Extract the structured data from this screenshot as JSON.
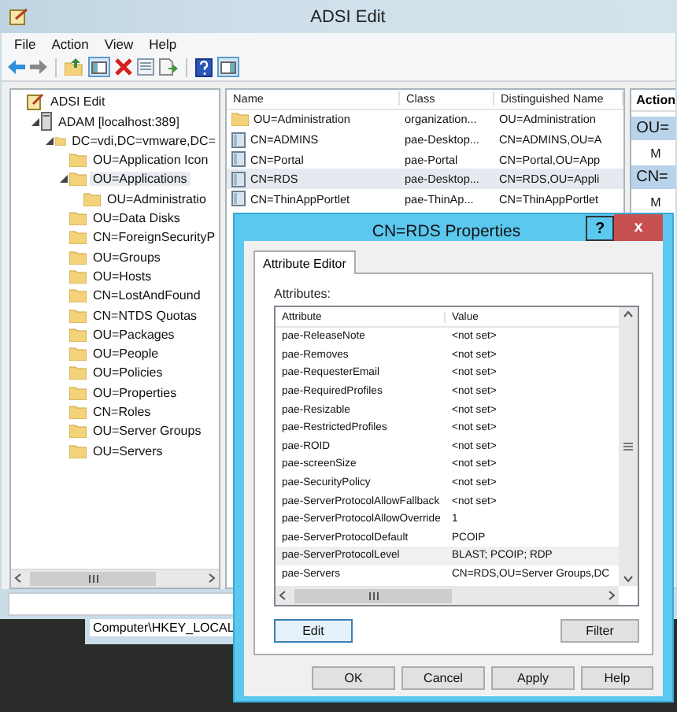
{
  "window": {
    "title": "ADSI Edit"
  },
  "menu": [
    "File",
    "Action",
    "View",
    "Help"
  ],
  "tree": [
    {
      "label": "ADSI Edit",
      "kind": "root",
      "selected": false,
      "children": [
        {
          "label": "ADAM [localhost:389]",
          "kind": "server",
          "selected": false,
          "expanded": true,
          "children": [
            {
              "label": "DC=vdi,DC=vmware,DC=",
              "kind": "folder",
              "selected": false,
              "expanded": true,
              "children": [
                {
                  "label": "OU=Application Icon",
                  "kind": "folder",
                  "selected": false
                },
                {
                  "label": "OU=Applications",
                  "kind": "folder",
                  "selected": true,
                  "expanded": true,
                  "children": [
                    {
                      "label": "OU=Administratio",
                      "kind": "folder",
                      "selected": false
                    }
                  ]
                },
                {
                  "label": "OU=Data Disks",
                  "kind": "folder",
                  "selected": false
                },
                {
                  "label": "CN=ForeignSecurityP",
                  "kind": "folder",
                  "selected": false
                },
                {
                  "label": "OU=Groups",
                  "kind": "folder",
                  "selected": false
                },
                {
                  "label": "OU=Hosts",
                  "kind": "folder",
                  "selected": false
                },
                {
                  "label": "CN=LostAndFound",
                  "kind": "folder",
                  "selected": false
                },
                {
                  "label": "CN=NTDS Quotas",
                  "kind": "folder",
                  "selected": false
                },
                {
                  "label": "OU=Packages",
                  "kind": "folder",
                  "selected": false
                },
                {
                  "label": "OU=People",
                  "kind": "folder",
                  "selected": false
                },
                {
                  "label": "OU=Policies",
                  "kind": "folder",
                  "selected": false
                },
                {
                  "label": "OU=Properties",
                  "kind": "folder",
                  "selected": false
                },
                {
                  "label": "CN=Roles",
                  "kind": "folder",
                  "selected": false
                },
                {
                  "label": "OU=Server Groups",
                  "kind": "folder",
                  "selected": false
                },
                {
                  "label": "OU=Servers",
                  "kind": "folder",
                  "selected": false
                }
              ]
            }
          ]
        }
      ]
    }
  ],
  "list": {
    "columns": [
      "Name",
      "Class",
      "Distinguished Name"
    ],
    "rows": [
      {
        "kind": "folder",
        "selected": false,
        "cells": [
          "OU=Administration",
          "organization...",
          "OU=Administration"
        ]
      },
      {
        "kind": "object",
        "selected": false,
        "cells": [
          "CN=ADMINS",
          "pae-Desktop...",
          "CN=ADMINS,OU=A"
        ]
      },
      {
        "kind": "object",
        "selected": false,
        "cells": [
          "CN=Portal",
          "pae-Portal",
          "CN=Portal,OU=App"
        ]
      },
      {
        "kind": "object",
        "selected": true,
        "cells": [
          "CN=RDS",
          "pae-Desktop...",
          "CN=RDS,OU=Appli"
        ]
      },
      {
        "kind": "object",
        "selected": false,
        "cells": [
          "CN=ThinAppPortlet",
          "pae-ThinAp...",
          "CN=ThinAppPortlet"
        ]
      }
    ]
  },
  "actions": {
    "title": "Action",
    "sections": [
      {
        "title": "OU=",
        "items": [
          "M"
        ]
      },
      {
        "title": "CN=",
        "items": [
          "M"
        ]
      }
    ]
  },
  "background_window": {
    "text": "Computer\\HKEY_LOCAL"
  },
  "dialog": {
    "title": "CN=RDS Properties",
    "help": "?",
    "close": "x",
    "tabs": [
      {
        "label": "Attribute Editor",
        "selected": true
      }
    ],
    "attributes_label": "Attributes:",
    "columns": [
      "Attribute",
      "Value"
    ],
    "rows": [
      {
        "attribute": "pae-ReleaseNote",
        "value": "<not set>",
        "selected": false
      },
      {
        "attribute": "pae-Removes",
        "value": "<not set>",
        "selected": false
      },
      {
        "attribute": "pae-RequesterEmail",
        "value": "<not set>",
        "selected": false
      },
      {
        "attribute": "pae-RequiredProfiles",
        "value": "<not set>",
        "selected": false
      },
      {
        "attribute": "pae-Resizable",
        "value": "<not set>",
        "selected": false
      },
      {
        "attribute": "pae-RestrictedProfiles",
        "value": "<not set>",
        "selected": false
      },
      {
        "attribute": "pae-ROID",
        "value": "<not set>",
        "selected": false
      },
      {
        "attribute": "pae-screenSize",
        "value": "<not set>",
        "selected": false
      },
      {
        "attribute": "pae-SecurityPolicy",
        "value": "<not set>",
        "selected": false
      },
      {
        "attribute": "pae-ServerProtocolAllowFallback",
        "value": "<not set>",
        "selected": false
      },
      {
        "attribute": "pae-ServerProtocolAllowOverride",
        "value": "1",
        "selected": false
      },
      {
        "attribute": "pae-ServerProtocolDefault",
        "value": "PCOIP",
        "selected": false
      },
      {
        "attribute": "pae-ServerProtocolLevel",
        "value": "BLAST; PCOIP; RDP",
        "selected": true
      },
      {
        "attribute": "pae-Servers",
        "value": "CN=RDS,OU=Server Groups,DC",
        "selected": false
      }
    ],
    "edit_button": "Edit",
    "filter_button": "Filter",
    "footer_buttons": [
      "OK",
      "Cancel",
      "Apply",
      "Help"
    ]
  }
}
